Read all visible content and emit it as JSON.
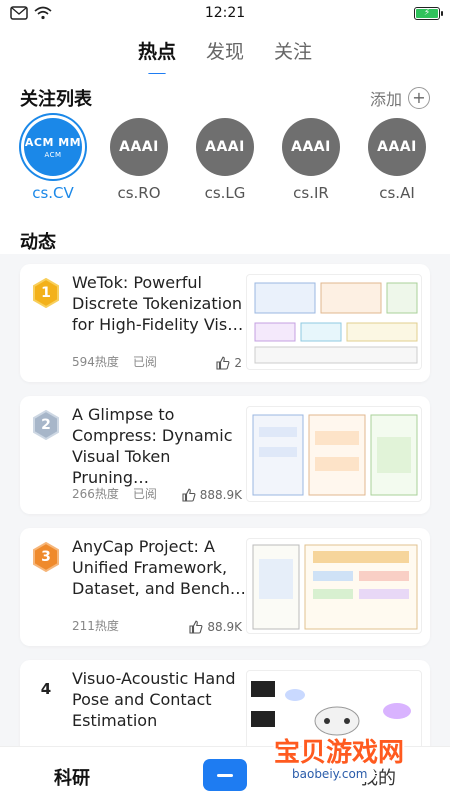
{
  "status": {
    "time": "12:21",
    "battery": "⚡"
  },
  "header": {
    "tabs": [
      {
        "label": "热点"
      },
      {
        "label": "发现"
      },
      {
        "label": "关注"
      }
    ]
  },
  "follow": {
    "title": "关注列表",
    "add_label": "添加",
    "items": [
      {
        "avatar": "ACM MM",
        "avatar_sub": "ACM",
        "label": "cs.CV"
      },
      {
        "avatar": "AAAI",
        "label": "cs.RO"
      },
      {
        "avatar": "AAAI",
        "label": "cs.LG"
      },
      {
        "avatar": "AAAI",
        "label": "cs.IR"
      },
      {
        "avatar": "AAAI",
        "label": "cs.AI"
      }
    ]
  },
  "feed": {
    "title": "动态",
    "items": [
      {
        "rank": "1",
        "title": "WeTok: Powerful Discrete Tokenization for High-Fidelity Vis…",
        "heat": "594热度",
        "read": "已阅",
        "likes": "2"
      },
      {
        "rank": "2",
        "title": "A Glimpse to Compress: Dynamic Visual Token Pruning…",
        "heat": "266热度",
        "read": "已阅",
        "likes": "888.9K"
      },
      {
        "rank": "3",
        "title": "AnyCap Project: A Unified Framework, Dataset, and Bench…",
        "heat": "211热度",
        "read": "",
        "likes": "88.9K"
      },
      {
        "rank": "4",
        "title": "Visuo-Acoustic Hand Pose and Contact Estimation",
        "heat": "",
        "read": "",
        "likes": ""
      }
    ]
  },
  "bottom_nav": {
    "left": "科研",
    "right": "我的"
  },
  "watermark": {
    "main": "宝贝游戏网",
    "sub": "baobeiy.com"
  },
  "colors": {
    "accent": "#1e7cf2",
    "gold": "#f3b11a",
    "silver": "#a7b6c9",
    "bronze": "#ef8a2c"
  }
}
